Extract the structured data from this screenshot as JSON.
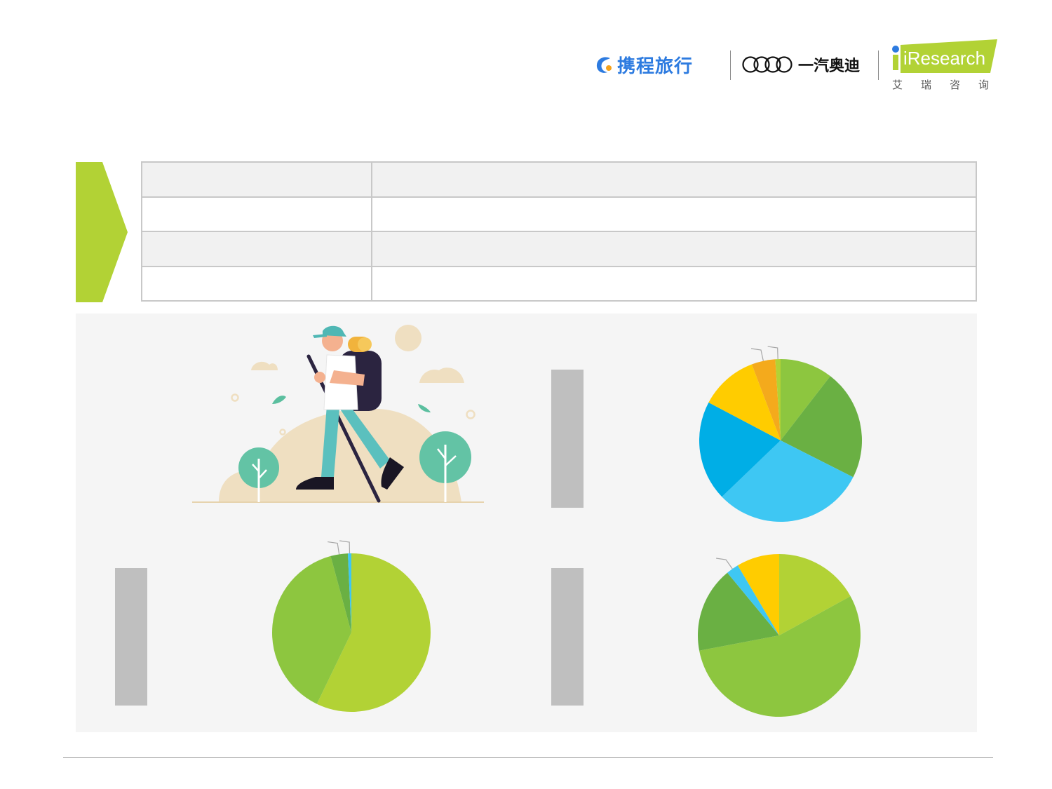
{
  "header": {
    "ctrip_logo_text": "携程旅行",
    "audi_logo_text": "一汽奥迪",
    "iresearch_logo_text": "iResearch",
    "iresearch_cn_text": "艾瑞咨询"
  },
  "table": {
    "rows": [
      {
        "label": "",
        "value": ""
      },
      {
        "label": "",
        "value": ""
      },
      {
        "label": "",
        "value": ""
      },
      {
        "label": "",
        "value": ""
      }
    ]
  },
  "colors": {
    "accent_green": "#b2d235",
    "panel_bg": "#f5f5f5",
    "bar_gray": "#bfbfbf"
  },
  "chart_data": [
    {
      "type": "pie",
      "slices": [
        {
          "value": 10,
          "color": "#8dc63f"
        },
        {
          "value": 21,
          "color": "#6ab043"
        },
        {
          "value": 29,
          "color": "#3ec7f3"
        },
        {
          "value": 19,
          "color": "#00aee6"
        },
        {
          "value": 11,
          "color": "#ffcc00"
        },
        {
          "value": 4.5,
          "color": "#f4aa1c"
        },
        {
          "value": 1,
          "color": "#b2d235"
        }
      ]
    },
    {
      "type": "pie",
      "slices": [
        {
          "value": 57,
          "color": "#b2d235"
        },
        {
          "value": 38.5,
          "color": "#8dc63f"
        },
        {
          "value": 3.5,
          "color": "#6ab043"
        },
        {
          "value": 0.7,
          "color": "#3ec7f3"
        }
      ]
    },
    {
      "type": "pie",
      "slices": [
        {
          "value": 17,
          "color": "#b2d235"
        },
        {
          "value": 55,
          "color": "#8dc63f"
        },
        {
          "value": 17,
          "color": "#6ab043"
        },
        {
          "value": 2.5,
          "color": "#3ec7f3"
        },
        {
          "value": 8.5,
          "color": "#ffcc00"
        }
      ]
    }
  ]
}
